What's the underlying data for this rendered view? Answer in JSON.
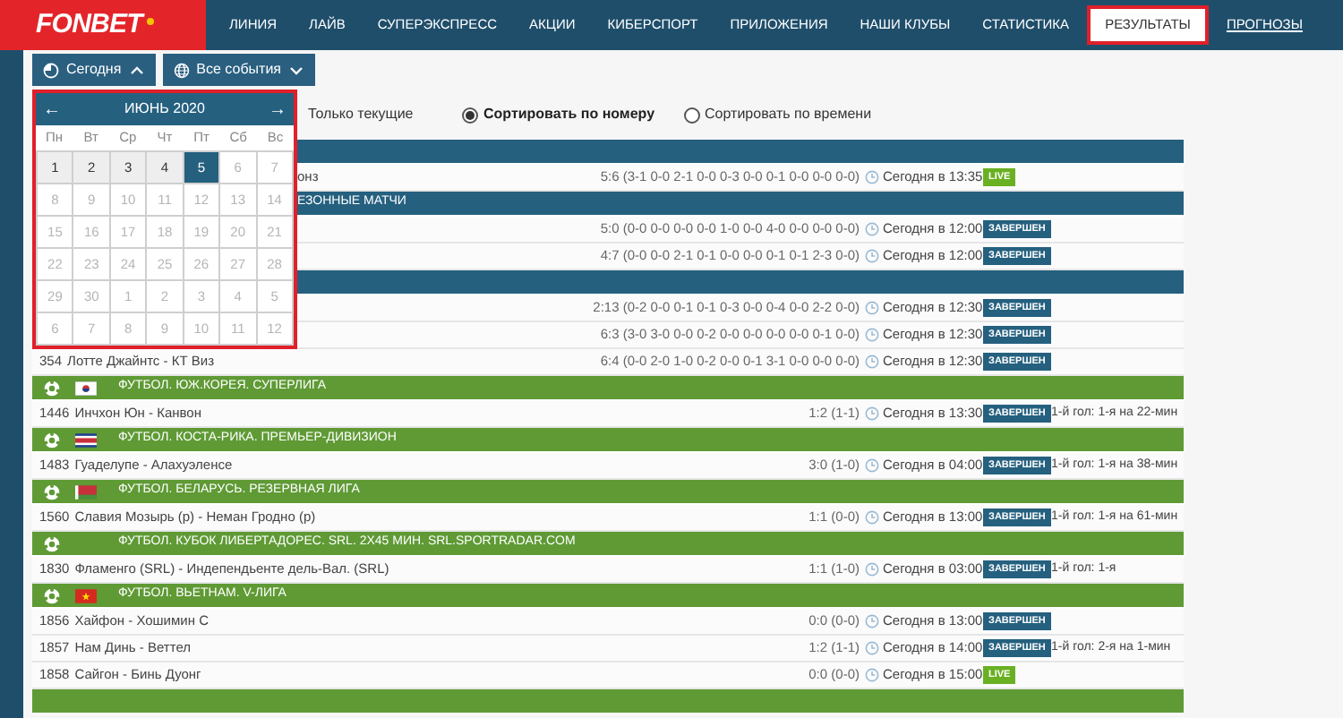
{
  "nav": {
    "logo": "FONBET",
    "items": [
      {
        "label": "ЛИНИЯ",
        "selected": false,
        "kind": "tab"
      },
      {
        "label": "ЛАЙВ",
        "selected": false,
        "kind": "tab"
      },
      {
        "label": "СУПЕРЭКСПРЕСС",
        "selected": false,
        "kind": "tab"
      },
      {
        "label": "АКЦИИ",
        "selected": false,
        "kind": "tab"
      },
      {
        "label": "КИБЕРСПОРТ",
        "selected": false,
        "kind": "tab"
      },
      {
        "label": "ПРИЛОЖЕНИЯ",
        "selected": false,
        "kind": "tab"
      },
      {
        "label": "НАШИ КЛУБЫ",
        "selected": false,
        "kind": "tab"
      },
      {
        "label": "СТАТИСТИКА",
        "selected": false,
        "kind": "tab"
      },
      {
        "label": "РЕЗУЛЬТАТЫ",
        "selected": true,
        "kind": "tab"
      },
      {
        "label": "ПРОГНОЗЫ",
        "kind": "link"
      }
    ]
  },
  "filters": {
    "date_button": {
      "label": "Сегодня",
      "expanded": true
    },
    "events_button": {
      "label": "Все события",
      "expanded": false
    },
    "current_only": "Только текущие",
    "sort_options": [
      {
        "label": "Сортировать по номеру",
        "selected": true
      },
      {
        "label": "Сортировать по времени",
        "selected": false
      }
    ]
  },
  "calendar": {
    "prev": "←",
    "month": "ИЮНЬ 2020",
    "next": "→",
    "weekdays": [
      "Пн",
      "Вт",
      "Ср",
      "Чт",
      "Пт",
      "Сб",
      "Вс"
    ],
    "days": [
      {
        "label": "1",
        "selected": false,
        "disabled": false
      },
      {
        "label": "2",
        "selected": false,
        "disabled": false
      },
      {
        "label": "3",
        "selected": false,
        "disabled": false
      },
      {
        "label": "4",
        "selected": false,
        "disabled": false
      },
      {
        "label": "5",
        "selected": true,
        "disabled": false
      },
      {
        "label": "6",
        "selected": false,
        "disabled": true
      },
      {
        "label": "7",
        "selected": false,
        "disabled": true
      },
      {
        "label": "8",
        "selected": false,
        "disabled": true
      },
      {
        "label": "9",
        "selected": false,
        "disabled": true
      },
      {
        "label": "10",
        "selected": false,
        "disabled": true
      },
      {
        "label": "11",
        "selected": false,
        "disabled": true
      },
      {
        "label": "12",
        "selected": false,
        "disabled": true
      },
      {
        "label": "13",
        "selected": false,
        "disabled": true
      },
      {
        "label": "14",
        "selected": false,
        "disabled": true
      },
      {
        "label": "15",
        "selected": false,
        "disabled": true
      },
      {
        "label": "16",
        "selected": false,
        "disabled": true
      },
      {
        "label": "17",
        "selected": false,
        "disabled": true
      },
      {
        "label": "18",
        "selected": false,
        "disabled": true
      },
      {
        "label": "19",
        "selected": false,
        "disabled": true
      },
      {
        "label": "20",
        "selected": false,
        "disabled": true
      },
      {
        "label": "21",
        "selected": false,
        "disabled": true
      },
      {
        "label": "22",
        "selected": false,
        "disabled": true
      },
      {
        "label": "23",
        "selected": false,
        "disabled": true
      },
      {
        "label": "24",
        "selected": false,
        "disabled": true
      },
      {
        "label": "25",
        "selected": false,
        "disabled": true
      },
      {
        "label": "26",
        "selected": false,
        "disabled": true
      },
      {
        "label": "27",
        "selected": false,
        "disabled": true
      },
      {
        "label": "28",
        "selected": false,
        "disabled": true
      },
      {
        "label": "29",
        "selected": false,
        "disabled": true
      },
      {
        "label": "30",
        "selected": false,
        "disabled": true
      },
      {
        "label": "1",
        "selected": false,
        "disabled": true
      },
      {
        "label": "2",
        "selected": false,
        "disabled": true
      },
      {
        "label": "3",
        "selected": false,
        "disabled": true
      },
      {
        "label": "4",
        "selected": false,
        "disabled": true
      },
      {
        "label": "5",
        "selected": false,
        "disabled": true
      },
      {
        "label": "6",
        "selected": false,
        "disabled": true
      },
      {
        "label": "7",
        "selected": false,
        "disabled": true
      },
      {
        "label": "8",
        "selected": false,
        "disabled": true
      },
      {
        "label": "9",
        "selected": false,
        "disabled": true
      },
      {
        "label": "10",
        "selected": false,
        "disabled": true
      },
      {
        "label": "11",
        "selected": false,
        "disabled": true
      },
      {
        "label": "12",
        "selected": false,
        "disabled": true
      }
    ]
  },
  "results": [
    {
      "color": "#25607f",
      "rows": [
        {
          "teams": "онз",
          "clipped": true,
          "score": "5:6 (3-1 0-0 2-1 0-0 0-3 0-0 0-1 0-0 0-0 0-0)",
          "time": "Сегодня в 13:35",
          "status": {
            "kind": "live",
            "label": "LIVE"
          }
        }
      ]
    },
    {
      "color": "#25607f",
      "title": "ЕЗОННЫЕ МАТЧИ",
      "clipped": true,
      "rows": [
        {
          "score": "5:0 (0-0 0-0 0-0 0-0 1-0 0-0 4-0 0-0 0-0 0-0)",
          "time": "Сегодня в 12:00",
          "status": {
            "kind": "finished",
            "label": "ЗАВЕРШЕН"
          }
        },
        {
          "score": "4:7 (0-0 0-0 2-1 0-1 0-0 0-0 0-1 0-1 2-3 0-0)",
          "time": "Сегодня в 12:00",
          "status": {
            "kind": "finished",
            "label": "ЗАВЕРШЕН"
          }
        }
      ]
    },
    {
      "color": "#25607f",
      "rows": [
        {
          "score": "2:13 (0-2 0-0 0-1 0-1 0-3 0-0 0-4 0-0 2-2 0-0)",
          "time": "Сегодня в 12:30",
          "status": {
            "kind": "finished",
            "label": "ЗАВЕРШЕН"
          }
        },
        {
          "score": "6:3 (3-0 3-0 0-0 0-2 0-0 0-0 0-0 0-0 0-1 0-0)",
          "time": "Сегодня в 12:30",
          "status": {
            "kind": "finished",
            "label": "ЗАВЕРШЕН"
          }
        },
        {
          "number": "354",
          "teams": "Лотте Джайнтс - КТ Виз",
          "score": "6:4 (0-0 2-0 1-0 0-2 0-0 0-1 3-1 0-0 0-0 0-0)",
          "time": "Сегодня в 12:30",
          "status": {
            "kind": "finished",
            "label": "ЗАВЕРШЕН"
          }
        }
      ]
    },
    {
      "color": "#5f9a35",
      "title": "ФУТБОЛ. ЮЖ.КОРЕЯ. СУПЕРЛИГА",
      "kind": "kr",
      "rows": [
        {
          "number": "1446",
          "teams": "Инчхон Юн - Канвон",
          "score": "1:2 (1-1)",
          "time": "Сегодня в 13:30",
          "status": {
            "kind": "finished",
            "label": "ЗАВЕРШЕН"
          },
          "goal": "1-й гол: 1-я на 22-мин"
        }
      ]
    },
    {
      "color": "#5f9a35",
      "title": "ФУТБОЛ. КОСТА-РИКА. ПРЕМЬЕР-ДИВИЗИОН",
      "kind": "cr",
      "rows": [
        {
          "number": "1483",
          "teams": "Гуаделупе - Алахуэленсе",
          "score": "3:0 (1-0)",
          "time": "Сегодня в 04:00",
          "status": {
            "kind": "finished",
            "label": "ЗАВЕРШЕН"
          },
          "goal": "1-й гол: 1-я на 38-мин"
        }
      ]
    },
    {
      "color": "#5f9a35",
      "title": "ФУТБОЛ. БЕЛАРУСЬ. РЕЗЕРВНАЯ ЛИГА",
      "kind": "by",
      "rows": [
        {
          "number": "1560",
          "teams": "Славия Мозырь (р) - Неман Гродно (р)",
          "score": "1:1 (0-0)",
          "time": "Сегодня в 13:00",
          "status": {
            "kind": "finished",
            "label": "ЗАВЕРШЕН"
          },
          "goal": "1-й гол: 1-я на 61-мин"
        }
      ]
    },
    {
      "color": "#5f9a35",
      "title": "ФУТБОЛ. КУБОК ЛИБЕРТАДОРЕС. SRL. 2Х45 МИН. SRL.SPORTRADAR.COM",
      "rows": [
        {
          "number": "1830",
          "teams": "Фламенго (SRL) - Индепендьенте дель-Вал. (SRL)",
          "score": "1:1 (1-0)",
          "time": "Сегодня в 03:00",
          "status": {
            "kind": "finished",
            "label": "ЗАВЕРШЕН"
          },
          "goal": "1-й гол: 1-я"
        }
      ]
    },
    {
      "color": "#5f9a35",
      "title": "ФУТБОЛ. ВЬЕТНАМ. V-ЛИГА",
      "kind": "vn",
      "rows": [
        {
          "number": "1856",
          "teams": "Хайфон - Хошимин С",
          "score": "0:0 (0-0)",
          "time": "Сегодня в 13:00",
          "status": {
            "kind": "finished",
            "label": "ЗАВЕРШЕН"
          }
        },
        {
          "number": "1857",
          "teams": "Нам Динь - Веттел",
          "score": "1:2 (1-1)",
          "time": "Сегодня в 14:00",
          "status": {
            "kind": "finished",
            "label": "ЗАВЕРШЕН"
          },
          "goal": "1-й гол: 2-я на 1-мин"
        },
        {
          "number": "1858",
          "teams": "Сайгон - Бинь Дуонг",
          "score": "0:0 (0-0)",
          "time": "Сегодня в 15:00",
          "status": {
            "kind": "live",
            "label": "LIVE"
          }
        }
      ]
    },
    {
      "color": "#5f9a35"
    }
  ]
}
